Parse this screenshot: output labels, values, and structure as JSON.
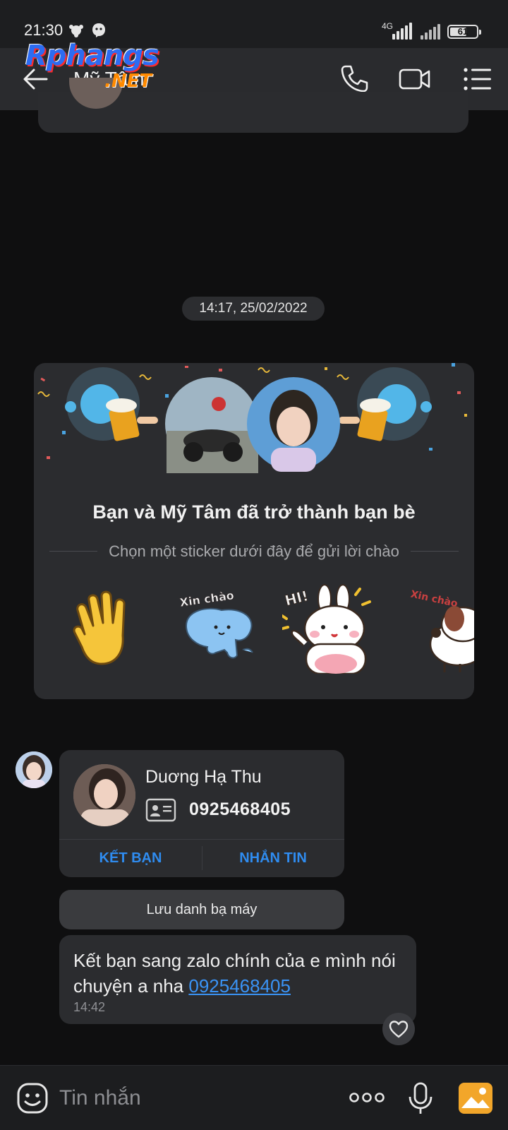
{
  "status_bar": {
    "time": "21:30",
    "network": "4G",
    "battery": "61"
  },
  "header": {
    "contact_name": "Mỹ Tâm",
    "watermark_main": "Rphangs",
    "watermark_sub": ".NET"
  },
  "date_separator": "14:17, 25/02/2022",
  "friend_card": {
    "title": "Bạn và Mỹ Tâm đã trở thành bạn bè",
    "subtitle": "Chọn một sticker dưới đây để gửi lời chào",
    "stickers": [
      "wave-hand",
      "xin-chao-cat",
      "hi-bunny",
      "xin-chao-dog"
    ],
    "sticker_captions": [
      "Xin chào",
      "HI!",
      "Xin chào"
    ]
  },
  "contact_card": {
    "name": "Duơng Hạ Thu",
    "phone": "0925468405",
    "add_friend_label": "KẾT BẠN",
    "message_label": "NHẮN TIN"
  },
  "save_contact_label": "Lưu danh bạ máy",
  "message": {
    "text": "Kết bạn sang zalo chính của e mình nói chuyện a nha ",
    "link": "0925468405",
    "time": "14:42"
  },
  "input_bar": {
    "placeholder": "Tin nhắn"
  },
  "colors": {
    "accent": "#2f8cf0",
    "background": "#0f0f10",
    "bubble": "#2b2c2f"
  }
}
